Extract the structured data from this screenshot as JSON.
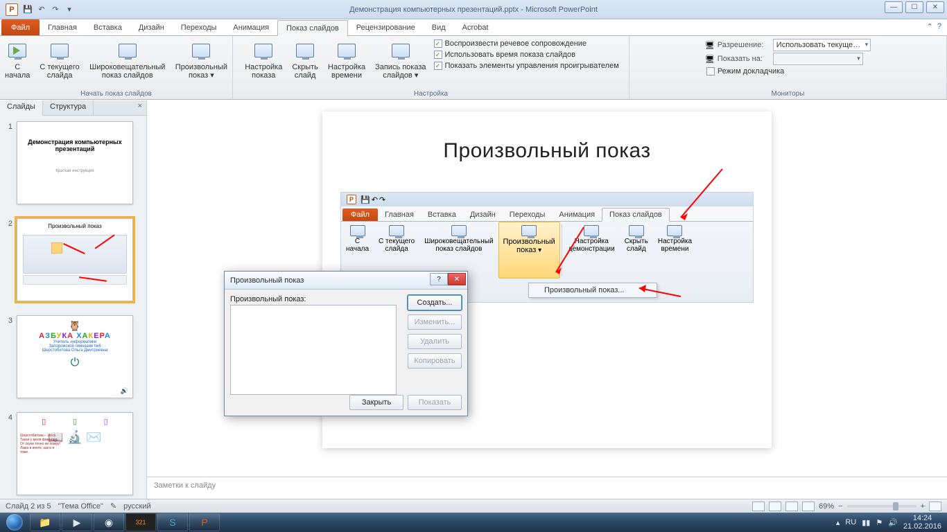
{
  "titlebar": {
    "doc": "Демонстрация компьютерных презентаций.pptx",
    "app": "Microsoft PowerPoint"
  },
  "tabs": {
    "file": "Файл",
    "items": [
      "Главная",
      "Вставка",
      "Дизайн",
      "Переходы",
      "Анимация",
      "Показ слайдов",
      "Рецензирование",
      "Вид",
      "Acrobat"
    ],
    "active_index": 5
  },
  "ribbon": {
    "group1": {
      "label": "Начать показ слайдов",
      "btn_from_start": "С\nначала",
      "btn_from_current": "С текущего\nслайда",
      "btn_broadcast": "Широковещательный\nпоказ слайдов",
      "btn_custom": "Произвольный\nпоказ"
    },
    "group2": {
      "label": "Настройка",
      "btn_setup": "Настройка\nпоказа",
      "btn_hide": "Скрыть\nслайд",
      "btn_rehearse": "Настройка\nвремени",
      "btn_record": "Запись показа\nслайдов",
      "opt_narration": "Воспроизвести речевое сопровождение",
      "opt_timings": "Использовать время показа слайдов",
      "opt_controls": "Показать элементы управления проигрывателем"
    },
    "group3": {
      "label": "Мониторы",
      "lbl_resolution": "Разрешение:",
      "val_resolution": "Использовать текуще…",
      "lbl_showon": "Показать на:",
      "chk_presenter": "Режим докладчика"
    }
  },
  "leftpane": {
    "tab_slides": "Слайды",
    "tab_outline": "Структура",
    "thumbs": [
      {
        "num": "1",
        "title": "Демонстрация компьютерных презентаций",
        "subtitle": "Краткая инструкция"
      },
      {
        "num": "2",
        "title": "Произвольный показ"
      },
      {
        "num": "3",
        "title": "АЗБУКА ХАКЕРА",
        "lines": [
          "Учитель информатики",
          "Запорожской гимназии №6",
          "Шерстобитова Ольга Дмитриевна"
        ]
      },
      {
        "num": "4",
        "title": ""
      }
    ],
    "selected": 1
  },
  "slide": {
    "title": "Произвольный показ",
    "mini_tabs": [
      "Главная",
      "Вставка",
      "Дизайн",
      "Переходы",
      "Анимация",
      "Показ слайдов"
    ],
    "mini_btns": {
      "from_start": "С\nначала",
      "from_current": "С текущего\nслайда",
      "broadcast": "Широковещательный\nпоказ слайдов",
      "custom": "Произвольный\nпоказ",
      "setup": "Настройка\nдемонстрации",
      "hide": "Скрыть\nслайд",
      "rehearse": "Настройка\nвремени"
    },
    "mini_group": "слайдов",
    "mini_dropdown": "Произвольный показ..."
  },
  "dialog": {
    "title": "Произвольный показ",
    "label": "Произвольный показ:",
    "btn_create": "Создать...",
    "btn_edit": "Изменить...",
    "btn_delete": "Удалить",
    "btn_copy": "Копировать",
    "btn_close": "Закрыть",
    "btn_show": "Показать"
  },
  "notes": "Заметки к слайду",
  "status": {
    "slide": "Слайд 2 из 5",
    "theme": "\"Тема Office\"",
    "lang": "русский",
    "zoom": "69%"
  },
  "taskbar": {
    "lang": "RU",
    "time": "14:24",
    "date": "21.02.2016"
  }
}
